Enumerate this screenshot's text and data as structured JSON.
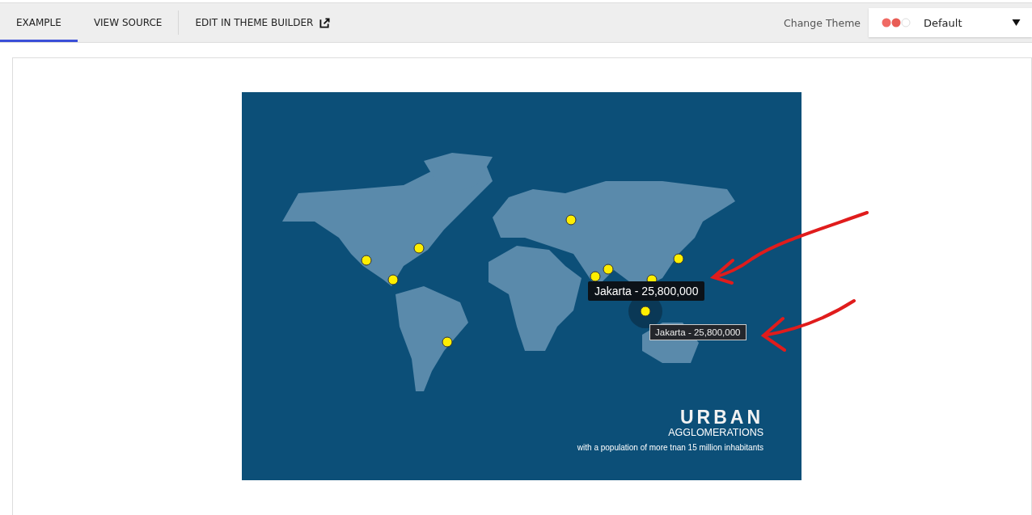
{
  "tabs": [
    {
      "label": "EXAMPLE",
      "selected": true,
      "external": false
    },
    {
      "label": "VIEW SOURCE",
      "selected": false,
      "external": false
    },
    {
      "label": "EDIT IN THEME BUILDER",
      "selected": false,
      "external": true
    }
  ],
  "theme": {
    "label": "Change Theme",
    "value": "Default"
  },
  "map": {
    "title": "URBAN",
    "subtitle": "AGGLOMERATIONS",
    "caption": "with a population of more tnan 15 million inhabitants",
    "tooltips": [
      {
        "kind": "dark",
        "text": "Jakarta - 25,800,000"
      },
      {
        "kind": "bordered",
        "text": "Jakarta - 25,800,000"
      }
    ]
  }
}
